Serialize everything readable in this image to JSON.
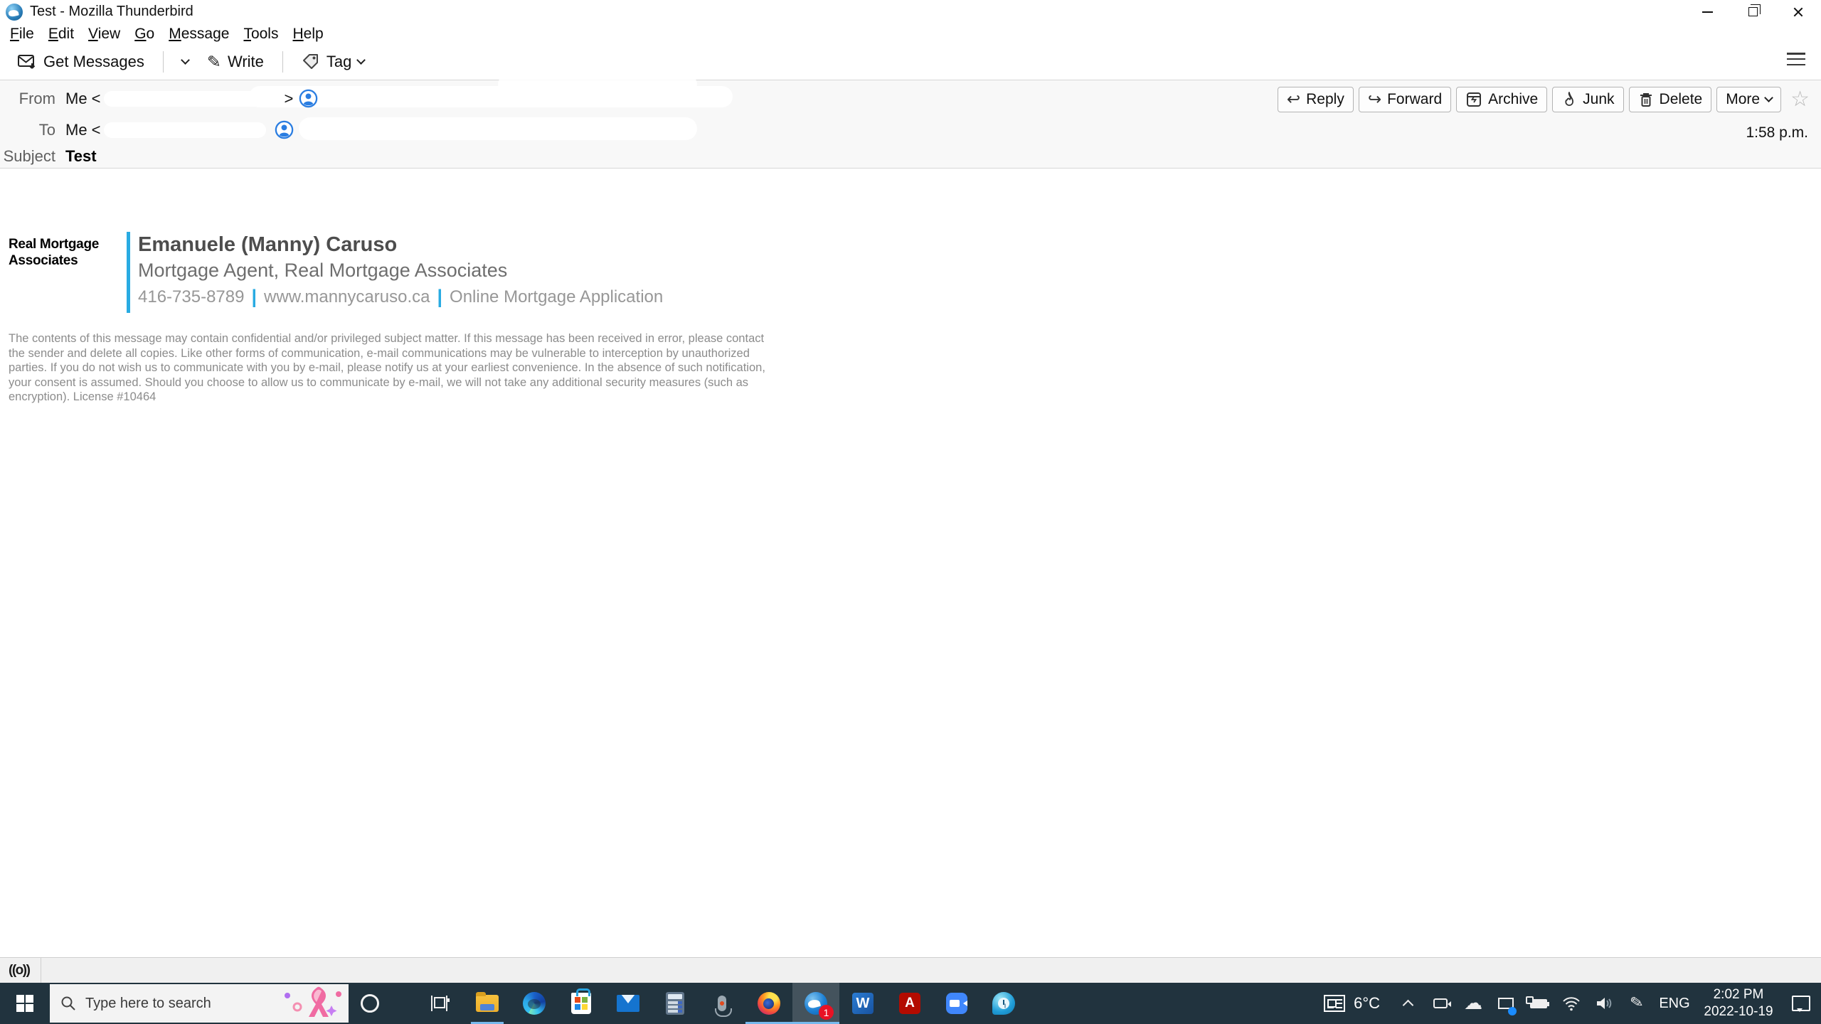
{
  "titlebar": {
    "title": "Test - Mozilla Thunderbird"
  },
  "menu_bar": {
    "items": [
      "File",
      "Edit",
      "View",
      "Go",
      "Message",
      "Tools",
      "Help"
    ]
  },
  "toolbar": {
    "get_messages": "Get Messages",
    "write": "Write",
    "tag": "Tag"
  },
  "message_header": {
    "from_label": "From",
    "from_value": "Me <",
    "from_close": ">",
    "to_label": "To",
    "to_value": "Me <",
    "subject_label": "Subject",
    "subject_value": "Test",
    "time": "1:58 p.m.",
    "actions": [
      {
        "label": "Reply",
        "icon": "reply-icon",
        "glyph": "↩"
      },
      {
        "label": "Forward",
        "icon": "forward-icon",
        "glyph": "↪"
      },
      {
        "label": "Archive",
        "icon": "archive-icon"
      },
      {
        "label": "Junk",
        "icon": "junk-flame-icon"
      },
      {
        "label": "Delete",
        "icon": "trash-icon"
      },
      {
        "label": "More",
        "icon": "chevron-down-icon"
      }
    ]
  },
  "message_body": {
    "signature": {
      "logo_line1": "Real Mortgage",
      "logo_line2": "Associates",
      "name": "Emanuele (Manny) Caruso",
      "job_title": "Mortgage Agent, Real Mortgage Associates",
      "contact": [
        "416-735-8789",
        "www.mannycaruso.ca",
        "Online Mortgage Application"
      ],
      "pipe": "|",
      "accent_color": "#29abe2"
    },
    "disclaimer_lines": [
      "The contents of this message may contain confidential and/or privileged subject matter. If this message has been received in error, please contact",
      "the sender and delete all copies. Like other forms of communication, e-mail communications may be vulnerable to interception by unauthorized",
      "parties. If you do not wish us to communicate with you by e-mail, please notify us at your earliest convenience. In the absence of such notification,",
      "your consent is assumed. Should you choose to allow us to communicate by e-mail, we will not take any additional security measures (such as",
      "encryption). License #10464"
    ]
  },
  "statusbar": {
    "broadcast_glyph": "((o))"
  },
  "taskbar": {
    "search_placeholder": "Type here to search",
    "weather_temp": "6°C",
    "language": "ENG",
    "clock_time": "2:02 PM",
    "clock_date": "2022-10-19",
    "thunderbird_badge": "1",
    "word_glyph": "W",
    "acrobat_glyph": "A",
    "colors": {
      "bar": "#21333e",
      "active_underline": "#76b9ed",
      "badge_red": "#e81224"
    }
  }
}
